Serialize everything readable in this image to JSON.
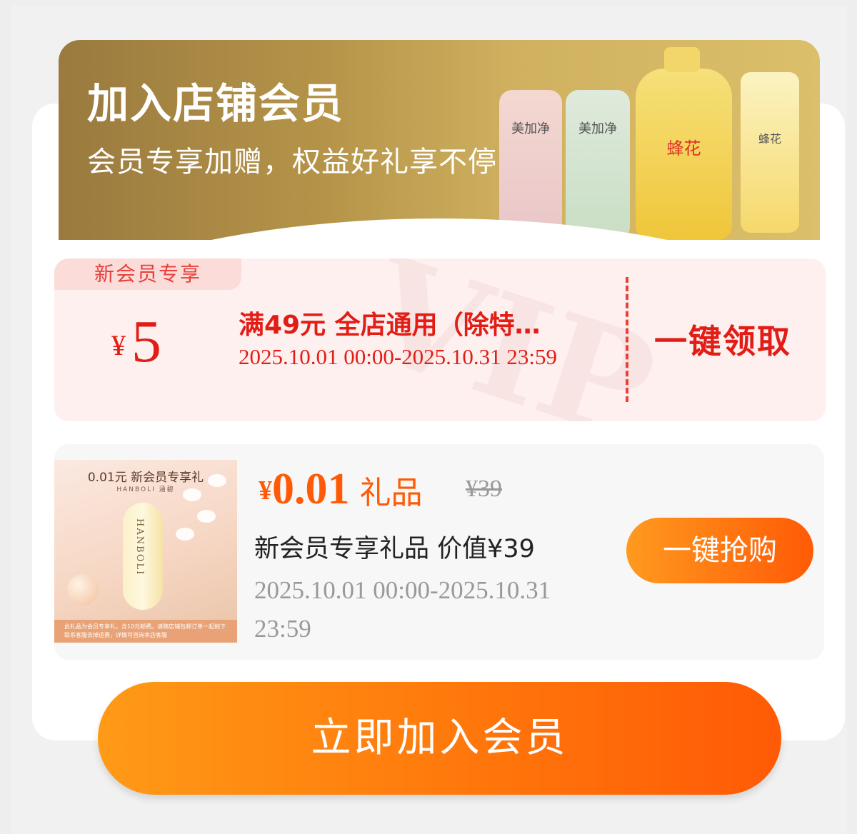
{
  "banner": {
    "title": "加入店铺会员",
    "subtitle": "会员专享加赠，权益好礼享不停",
    "product_labels": [
      "美加净",
      "美加净",
      "蜂花",
      "蜂花"
    ]
  },
  "coupon": {
    "tag": "新会员专享",
    "currency": "¥",
    "amount": "5",
    "condition": "满49元 全店通用（除特…",
    "valid_time": "2025.10.01 00:00-2025.10.31 23:59",
    "claim_label": "一键领取",
    "watermark": "VIP"
  },
  "gift": {
    "image_title": "0.01元 新会员专享礼",
    "image_brand": "HANBOLI 涵碧",
    "image_product_text": "HANBOLI",
    "image_note": "此礼品为会员专享礼，含10元邮费。请随店铺包邮订单一起拍下 联系客服去掉运费，详情可咨询本店客服",
    "currency": "¥",
    "price": "0.01",
    "type": "礼品",
    "original_price": "¥39",
    "name": "新会员专享礼品 价值¥39",
    "valid_time": "2025.10.01 00:00-2025.10.31 23:59",
    "buy_label": "一键抢购"
  },
  "join_button": "立即加入会员",
  "colors": {
    "accent_red": "#e21d16",
    "accent_orange": "#ff5a06",
    "banner_gold": "#b59449"
  }
}
